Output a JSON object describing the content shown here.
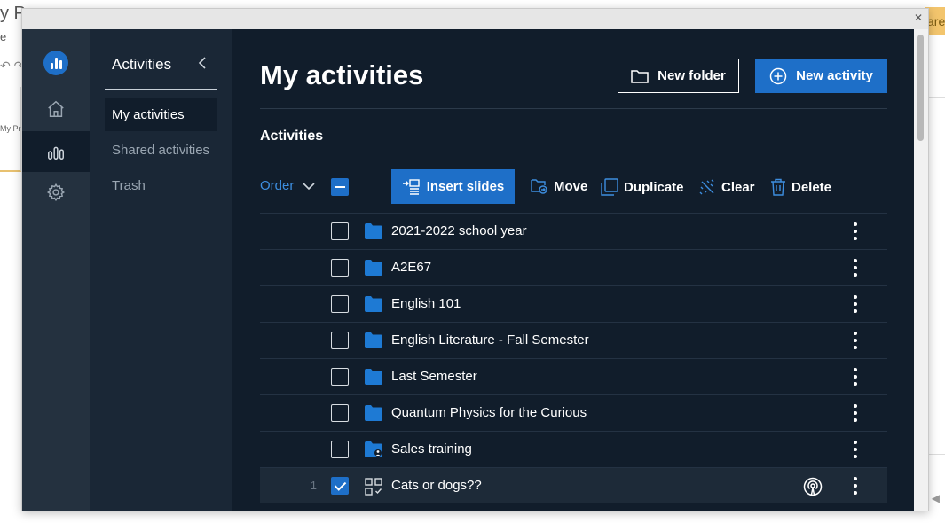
{
  "background": {
    "title": "y P",
    "subtitle": "e",
    "thumb_text": "My Pr",
    "share_label": "are"
  },
  "nav": {
    "title": "Activities",
    "items": [
      {
        "label": "My activities"
      },
      {
        "label": "Shared activities"
      },
      {
        "label": "Trash"
      }
    ]
  },
  "main": {
    "title": "My activities",
    "new_folder_label": "New folder",
    "new_activity_label": "New activity",
    "section_title": "Activities",
    "order_label": "Order",
    "toolbar": {
      "insert_slides": "Insert slides",
      "move": "Move",
      "duplicate": "Duplicate",
      "clear": "Clear",
      "delete": "Delete"
    }
  },
  "rows": [
    {
      "label": "2021-2022 school year",
      "type": "folder",
      "checked": false,
      "number": ""
    },
    {
      "label": "A2E67",
      "type": "folder",
      "checked": false,
      "number": ""
    },
    {
      "label": "English 101",
      "type": "folder",
      "checked": false,
      "number": ""
    },
    {
      "label": "English Literature - Fall Semester",
      "type": "folder",
      "checked": false,
      "number": ""
    },
    {
      "label": "Last Semester",
      "type": "folder",
      "checked": false,
      "number": ""
    },
    {
      "label": "Quantum Physics for the Curious",
      "type": "folder",
      "checked": false,
      "number": ""
    },
    {
      "label": "Sales training",
      "type": "shared-folder",
      "checked": false,
      "number": ""
    },
    {
      "label": "Cats or dogs??",
      "type": "activity",
      "checked": true,
      "number": "1"
    }
  ],
  "colors": {
    "accent": "#1e6fc8",
    "background": "#111d2b",
    "rail": "#24313f",
    "nav": "#1a2736"
  }
}
